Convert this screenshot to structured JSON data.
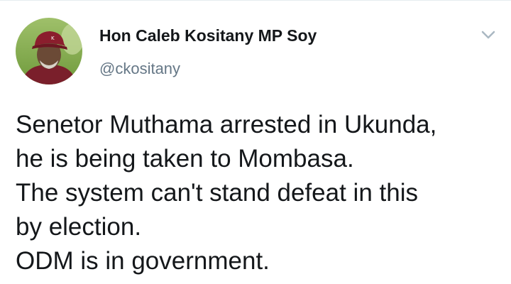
{
  "tweet": {
    "author_name": "Hon Caleb Kositany MP Soy",
    "author_handle": "@ckositany",
    "avatar_icon": "profile-photo-man-with-cap",
    "menu_icon": "chevron-down-icon",
    "body_lines": [
      "Senetor Muthama arrested in Ukunda,",
      "he is being taken to Mombasa.",
      "The system can't stand defeat in this",
      "by election.",
      "ODM is in government."
    ]
  },
  "colors": {
    "text": "#14171a",
    "secondary_text": "#657786",
    "caret": "#aab8c2"
  }
}
